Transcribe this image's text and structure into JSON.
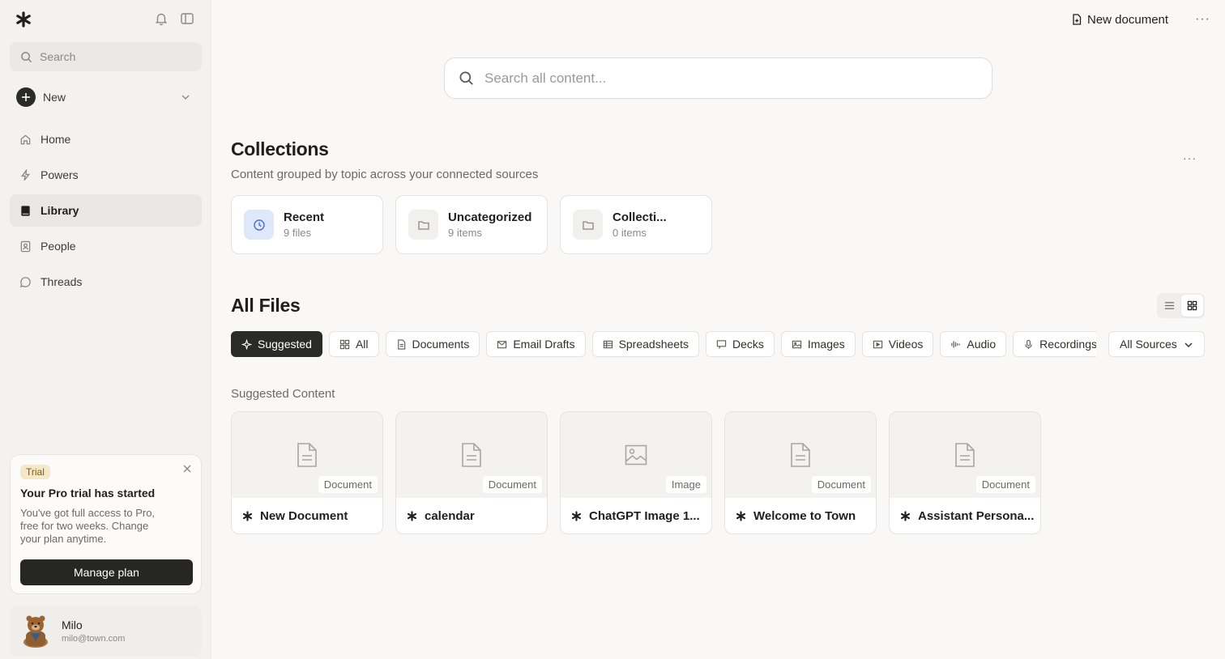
{
  "sidebar": {
    "logo_icon": "asterisk-logo",
    "search_placeholder": "Search",
    "new_label": "New",
    "nav": [
      {
        "label": "Home",
        "icon": "home-icon"
      },
      {
        "label": "Powers",
        "icon": "lightning-icon"
      },
      {
        "label": "Library",
        "icon": "book-icon",
        "active": true
      },
      {
        "label": "People",
        "icon": "contact-icon"
      },
      {
        "label": "Threads",
        "icon": "chat-bubble-icon"
      }
    ],
    "trial": {
      "badge": "Trial",
      "title": "Your Pro trial has started",
      "description": "You've got full access to Pro, free for two weeks. Change your plan anytime.",
      "button": "Manage plan"
    },
    "user": {
      "name": "Milo",
      "email": "milo@town.com"
    }
  },
  "topbar": {
    "new_document": "New document",
    "more": "···"
  },
  "main": {
    "search_placeholder": "Search all content...",
    "collections": {
      "title": "Collections",
      "subtitle": "Content grouped by topic across your connected sources",
      "more": "···",
      "cards": [
        {
          "name": "Recent",
          "count": "9 files",
          "icon": "clock-icon"
        },
        {
          "name": "Uncategorized",
          "count": "9 items",
          "icon": "folder-icon"
        },
        {
          "name": "Collecti...",
          "count": "0 items",
          "icon": "folder-icon"
        }
      ]
    },
    "all_files": {
      "title": "All Files",
      "filters": [
        {
          "label": "Suggested",
          "icon": "sparkle-icon",
          "active": true
        },
        {
          "label": "All",
          "icon": "grid-icon"
        },
        {
          "label": "Documents",
          "icon": "document-icon"
        },
        {
          "label": "Email Drafts",
          "icon": "mail-icon"
        },
        {
          "label": "Spreadsheets",
          "icon": "table-icon"
        },
        {
          "label": "Decks",
          "icon": "presentation-icon"
        },
        {
          "label": "Images",
          "icon": "image-icon"
        },
        {
          "label": "Videos",
          "icon": "video-icon"
        },
        {
          "label": "Audio",
          "icon": "waveform-icon"
        },
        {
          "label": "Recordings",
          "icon": "microphone-icon"
        }
      ],
      "sources_select": "All Sources",
      "suggested_label": "Suggested Content",
      "files": [
        {
          "name": "New Document",
          "type": "Document"
        },
        {
          "name": "calendar",
          "type": "Document"
        },
        {
          "name": "ChatGPT Image 1...",
          "type": "Image"
        },
        {
          "name": "Welcome to Town",
          "type": "Document"
        },
        {
          "name": "Assistant Persona...",
          "type": "Document"
        }
      ]
    }
  }
}
